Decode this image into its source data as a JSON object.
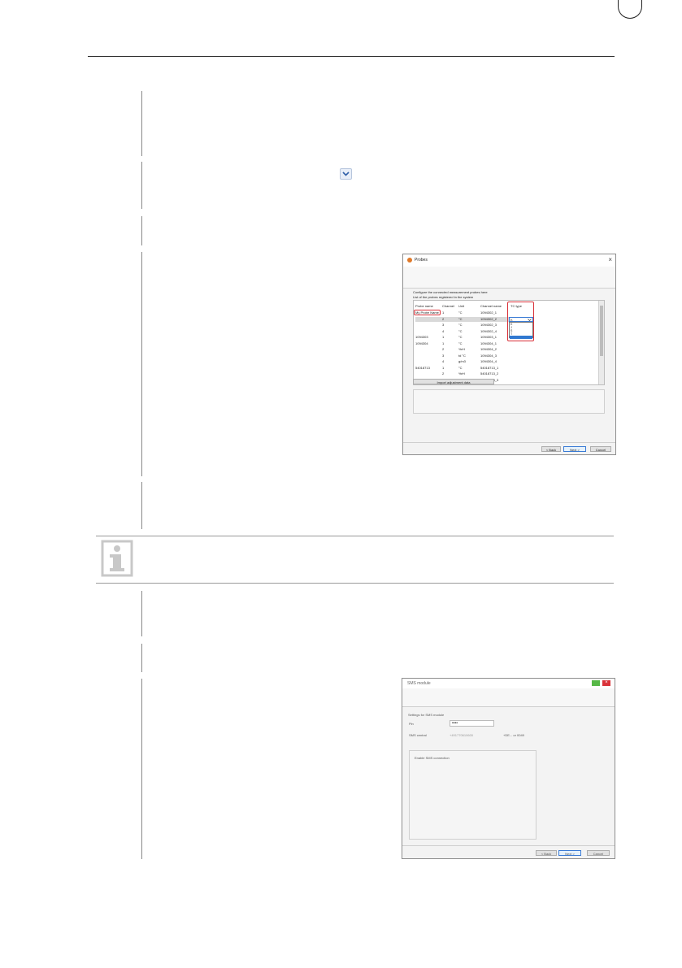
{
  "probes_dialog": {
    "title": "Probes",
    "close_glyph": "×",
    "instruction": "Configure the connected measurement probes here",
    "list_label": "List of the probes registered in the system",
    "columns": [
      "Probe name",
      "Channel",
      "Unit",
      "Channel name",
      "TC type"
    ],
    "rows": [
      [
        "My Probe Name",
        "1",
        "°C",
        "1094302_1",
        "K"
      ],
      [
        "",
        "2",
        "°C",
        "1094302_2",
        ""
      ],
      [
        "",
        "3",
        "°C",
        "1094302_3",
        ""
      ],
      [
        "",
        "4",
        "°C",
        "1094302_4",
        ""
      ],
      [
        "1094303",
        "1",
        "°C",
        "1094303_1",
        ""
      ],
      [
        "1094304",
        "1",
        "°C",
        "1094304_1",
        ""
      ],
      [
        "",
        "2",
        "%rH",
        "1094304_2",
        ""
      ],
      [
        "",
        "3",
        "td °C",
        "1094304_3",
        ""
      ],
      [
        "",
        "4",
        "g/m3",
        "1094304_4",
        ""
      ],
      [
        "54018713",
        "1",
        "°C",
        "54018713_1",
        ""
      ],
      [
        "",
        "2",
        "%rH",
        "54018713_2",
        ""
      ],
      [
        "",
        "3",
        "td °C",
        "54018713_3",
        ""
      ]
    ],
    "tc_selected": "K",
    "tc_options": [
      "K",
      "J",
      "S",
      "T"
    ],
    "import_button": "Import adjustment data",
    "back_button": "< Back",
    "next_button": "Next >",
    "cancel_button": "Cancel"
  },
  "sms_dialog": {
    "title": "SMS module",
    "settings_label": "Settings for SMS module",
    "pin_label": "Pin",
    "pin_value": "••••",
    "sms_center_label": "SMS central",
    "sms_center_value": "+491770610600",
    "sms_center_hint": "+DE... or 0049",
    "enable_label": "Enable SMS connection",
    "back_button": "< Back",
    "next_button": "Next >",
    "cancel_button": "Cancel"
  },
  "icons": {
    "info": "info-icon",
    "dropdown": "chevron-down-icon",
    "accent": "#3a7bd5",
    "highlight": "#d9323a"
  }
}
